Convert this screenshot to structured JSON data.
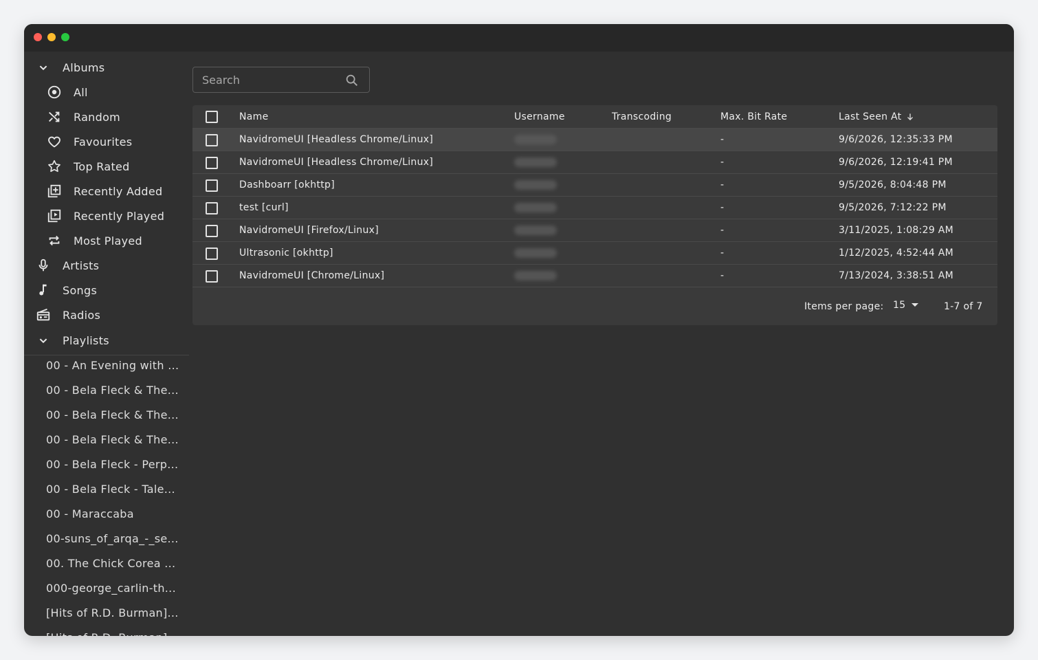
{
  "sidebar": {
    "albums_label": "Albums",
    "album_items": [
      {
        "label": "All",
        "icon": "album-disc-icon"
      },
      {
        "label": "Random",
        "icon": "shuffle-icon"
      },
      {
        "label": "Favourites",
        "icon": "heart-icon"
      },
      {
        "label": "Top Rated",
        "icon": "star-icon"
      },
      {
        "label": "Recently Added",
        "icon": "library-add-icon"
      },
      {
        "label": "Recently Played",
        "icon": "video-library-icon"
      },
      {
        "label": "Most Played",
        "icon": "repeat-icon"
      }
    ],
    "artists_label": "Artists",
    "songs_label": "Songs",
    "radios_label": "Radios",
    "playlists_label": "Playlists",
    "playlists": [
      "00 - An Evening with ...",
      "00 - Bela Fleck & The...",
      "00 - Bela Fleck & The...",
      "00 - Bela Fleck & The...",
      "00 - Bela Fleck - Perp...",
      "00 - Bela Fleck - Tale...",
      "00 - Maraccaba",
      "00-suns_of_arqa_-_se...",
      "00. The Chick Corea ...",
      "000-george_carlin-th...",
      "[Hits of R.D. Burman]...",
      "[Hits of R.D. Burman]"
    ]
  },
  "search": {
    "placeholder": "Search"
  },
  "table": {
    "headers": {
      "name": "Name",
      "username": "Username",
      "transcoding": "Transcoding",
      "max_bit_rate": "Max. Bit Rate",
      "last_seen_at": "Last Seen At"
    },
    "rows": [
      {
        "name": "NavidromeUI [Headless Chrome/Linux]",
        "bit_rate": "-",
        "last_seen": "9/6/2026, 12:35:33 PM"
      },
      {
        "name": "NavidromeUI [Headless Chrome/Linux]",
        "bit_rate": "-",
        "last_seen": "9/6/2026, 12:19:41 PM"
      },
      {
        "name": "Dashboarr [okhttp]",
        "bit_rate": "-",
        "last_seen": "9/5/2026, 8:04:48 PM"
      },
      {
        "name": "test [curl]",
        "bit_rate": "-",
        "last_seen": "9/5/2026, 7:12:22 PM"
      },
      {
        "name": "NavidromeUI [Firefox/Linux]",
        "bit_rate": "-",
        "last_seen": "3/11/2025, 1:08:29 AM"
      },
      {
        "name": "Ultrasonic [okhttp]",
        "bit_rate": "-",
        "last_seen": "1/12/2025, 4:52:44 AM"
      },
      {
        "name": "NavidromeUI [Chrome/Linux]",
        "bit_rate": "-",
        "last_seen": "7/13/2024, 3:38:51 AM"
      }
    ]
  },
  "pagination": {
    "items_per_page_label": "Items per page:",
    "items_per_page": "15",
    "range": "1-7 of 7"
  }
}
